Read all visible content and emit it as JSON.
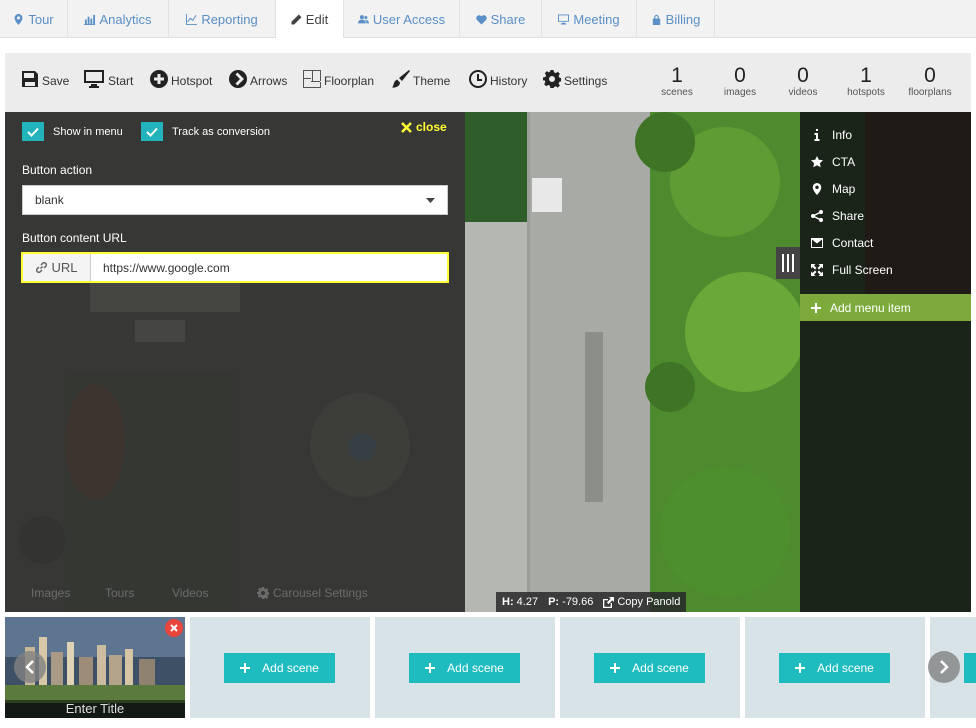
{
  "tabs": [
    {
      "label": "Tour",
      "icon": "map-marker-icon"
    },
    {
      "label": "Analytics",
      "icon": "bar-chart-icon"
    },
    {
      "label": "Reporting",
      "icon": "line-chart-icon"
    },
    {
      "label": "Edit",
      "icon": "pencil-icon"
    },
    {
      "label": "User Access",
      "icon": "users-icon"
    },
    {
      "label": "Share",
      "icon": "heart-icon"
    },
    {
      "label": "Meeting",
      "icon": "monitor-icon"
    },
    {
      "label": "Billing",
      "icon": "lock-icon"
    }
  ],
  "toolbar": {
    "save": "Save",
    "start": "Start",
    "hotspot": "Hotspot",
    "arrows": "Arrows",
    "floorplan": "Floorplan",
    "theme": "Theme",
    "history": "History",
    "settings": "Settings"
  },
  "stats": [
    {
      "n": "1",
      "label": "scenes"
    },
    {
      "n": "0",
      "label": "images"
    },
    {
      "n": "0",
      "label": "videos"
    },
    {
      "n": "1",
      "label": "hotspots"
    },
    {
      "n": "0",
      "label": "floorplans"
    }
  ],
  "panel": {
    "show_in_menu": "Show in menu",
    "track_conversion": "Track as conversion",
    "close": "close",
    "button_action_label": "Button action",
    "button_action_value": "blank",
    "content_url_label": "Button content URL",
    "url_prefix": "URL",
    "url_value": "https://www.google.com"
  },
  "faded_tabs": {
    "images": "Images",
    "tours": "Tours",
    "videos": "Videos",
    "carousel": "Carousel Settings"
  },
  "menu": {
    "items": [
      {
        "label": "Info",
        "icon": "info-icon"
      },
      {
        "label": "CTA",
        "icon": "star-icon"
      },
      {
        "label": "Map",
        "icon": "map-marker-icon"
      },
      {
        "label": "Share",
        "icon": "share-icon"
      },
      {
        "label": "Contact",
        "icon": "envelope-icon"
      },
      {
        "label": "Full Screen",
        "icon": "expand-icon"
      }
    ],
    "add": "Add menu item"
  },
  "coords": {
    "h_label": "H:",
    "h": "4.27",
    "p_label": "P:",
    "p": "-79.66",
    "copy": "Copy Panold"
  },
  "strip": {
    "enter_title": "Enter Title",
    "add_scene": "Add scene"
  },
  "colors": {
    "accent": "#22b3bb",
    "menu_add": "#7cab3c",
    "highlight": "#ffff33",
    "tab_link": "#5a8fc7"
  }
}
